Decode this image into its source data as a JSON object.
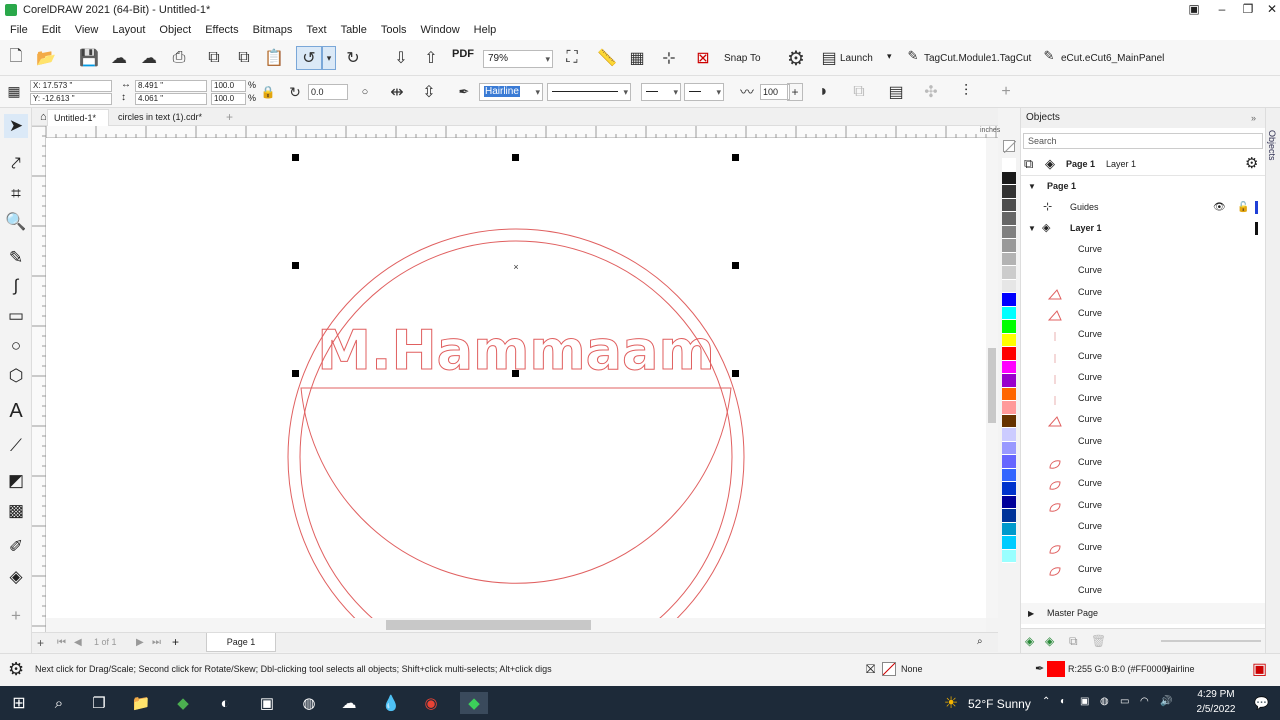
{
  "window": {
    "title": "CorelDRAW 2021 (64-Bit) - Untitled-1*"
  },
  "menu": [
    "File",
    "Edit",
    "View",
    "Layout",
    "Object",
    "Effects",
    "Bitmaps",
    "Text",
    "Table",
    "Tools",
    "Window",
    "Help"
  ],
  "standard_toolbar": {
    "zoom": "79%",
    "snap_to": "Snap To",
    "launch": "Launch",
    "macro1": "TagCut.Module1.TagCut",
    "macro2": "eCut.eCut6_MainPanel",
    "pdf": "PDF"
  },
  "property_bar": {
    "x": "X: 17.573 \"",
    "y": "Y: -12.613 \"",
    "width": "8.491 \"",
    "height": "4.061 \"",
    "scale_x": "100.0",
    "scale_y": "100.0",
    "pct1": "%",
    "pct2": "%",
    "rotation": "0.0",
    "outline_width": "Hairline",
    "outline_value": "100"
  },
  "doc_tabs": [
    "Untitled-1*",
    "circles in text (1).cdr*"
  ],
  "ruler_units": "inches",
  "canvas_text": "M.Hammaam",
  "page_nav": {
    "counter": "1  of  1",
    "page_tab": "Page 1"
  },
  "palette_colors": [
    "#ffffff",
    "#1a1a1a",
    "#333333",
    "#4d4d4d",
    "#666666",
    "#808080",
    "#999999",
    "#b3b3b3",
    "#cccccc",
    "#e6e6e6",
    "#0000ff",
    "#00ffff",
    "#00ff00",
    "#ffff00",
    "#ff0000",
    "#ff00ff",
    "#9900cc",
    "#ff6600",
    "#ff9999",
    "#663300",
    "#ccccff",
    "#9999ff",
    "#6666ff",
    "#3366ff",
    "#0033cc",
    "#000099",
    "#003399",
    "#0099cc",
    "#00ccff",
    "#99ffff"
  ],
  "objects_docker": {
    "title": "Objects",
    "search_placeholder": "Search",
    "page_label": "Page 1",
    "layer_label": "Layer 1",
    "tree_page": "Page 1",
    "guides": "Guides",
    "layer": "Layer 1",
    "curves": [
      "Curve",
      "Curve",
      "Curve",
      "Curve",
      "Curve",
      "Curve",
      "Curve",
      "Curve",
      "Curve",
      "Curve",
      "Curve",
      "Curve",
      "Curve",
      "Curve",
      "Curve",
      "Curve",
      "Curve"
    ],
    "master_page": "Master Page",
    "side_tab": "Objects"
  },
  "status_bar": {
    "hint": "Next click for Drag/Scale; Second click for Rotate/Skew; Dbl-clicking tool selects all objects; Shift+click multi-selects; Alt+click digs",
    "fill": "None",
    "outline_color": "R:255 G:0 B:0 (#FF0000)",
    "outline_width": "Hairline",
    "outline_swatch": "#ff0000"
  },
  "taskbar": {
    "weather": "52°F  Sunny",
    "time": "4:29 PM",
    "date": "2/5/2022"
  }
}
